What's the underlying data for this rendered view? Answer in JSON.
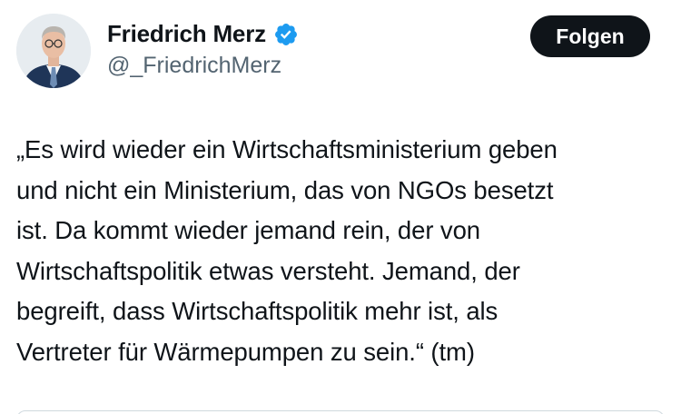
{
  "author": {
    "display_name": "Friedrich Merz",
    "handle": "@_FriedrichMerz",
    "verified": true,
    "verified_badge_color": "#1d9bf0",
    "avatar_icon": "profile-photo"
  },
  "actions": {
    "follow_label": "Folgen"
  },
  "tweet": {
    "text": "„Es wird wieder ein Wirtschaftsministerium geben\nund nicht ein Ministerium, das von NGOs besetzt\nist. Da kommt wieder jemand rein, der von\nWirtschaftspolitik etwas versteht. Jemand, der\nbegreift, dass Wirtschaftspolitik mehr ist, als\nVertreter für Wärmepumpen zu sein.“ (tm)"
  },
  "colors": {
    "text_primary": "#0f1419",
    "text_secondary": "#536471",
    "button_background": "#0f1419",
    "button_text": "#ffffff"
  }
}
